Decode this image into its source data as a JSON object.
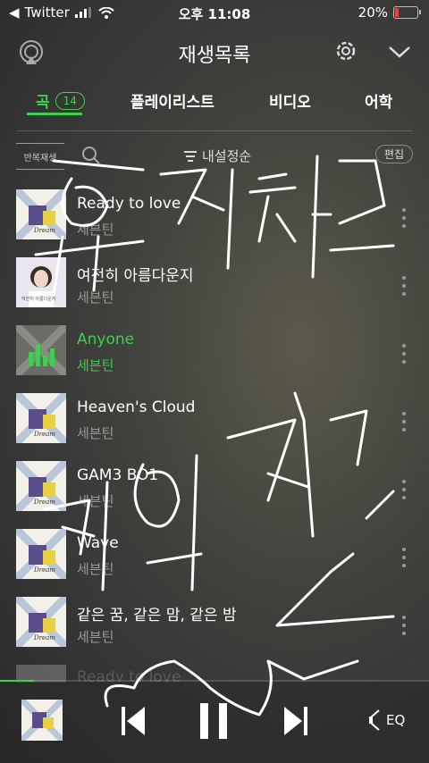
{
  "status": {
    "carrier": "Twitter",
    "time": "오후 11:08",
    "battery": "20%"
  },
  "header": {
    "title": "재생목록"
  },
  "tabs": {
    "songs": "곡",
    "songs_count": "14",
    "playlist": "플레이리스트",
    "video": "비디오",
    "language": "어학"
  },
  "toolbar": {
    "repeat": "반복재생",
    "sort": "내설정순",
    "edit": "편집"
  },
  "songs": [
    {
      "title": "Ready to love",
      "artist": "세븐틴"
    },
    {
      "title": "여전히 아름다운지",
      "artist": "세븐틴"
    },
    {
      "title": "Anyone",
      "artist": "세븐틴"
    },
    {
      "title": "Heaven's Cloud",
      "artist": "세븐틴"
    },
    {
      "title": "GAM3 BO1",
      "artist": "세븐틴"
    },
    {
      "title": "Wave",
      "artist": "세븐틴"
    },
    {
      "title": "같은 꿈, 같은 맘, 같은 밤",
      "artist": "세븐틴"
    },
    {
      "title": "Ready to love",
      "artist": ""
    }
  ],
  "player": {
    "eq": "EQ",
    "progress": 0.08
  },
  "colors": {
    "accent": "#3fce4f"
  }
}
